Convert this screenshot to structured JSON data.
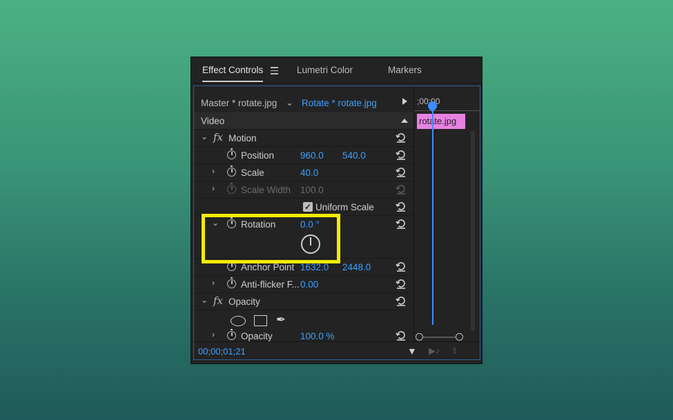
{
  "tabs": [
    {
      "label": "Effect Controls",
      "active": true
    },
    {
      "label": "Lumetri Color",
      "active": false
    },
    {
      "label": "Markers",
      "active": false
    }
  ],
  "clip_selector": {
    "master": "Master * rotate.jpg",
    "current": "Rotate * rotate.jpg"
  },
  "timeline": {
    "time": ";00:00",
    "clip_label": "rotate.jpg"
  },
  "section_video": "Video",
  "motion": {
    "title": "Motion",
    "position": {
      "label": "Position",
      "x": "960.0",
      "y": "540.0"
    },
    "scale": {
      "label": "Scale",
      "value": "40.0"
    },
    "scale_width": {
      "label": "Scale Width",
      "value": "100.0"
    },
    "uniform_scale": {
      "label": "Uniform Scale",
      "checked": true
    },
    "rotation": {
      "label": "Rotation",
      "value": "0.0 °"
    },
    "anchor_point": {
      "label": "Anchor Point",
      "x": "1632.0",
      "y": "2448.0"
    },
    "anti_flicker": {
      "label": "Anti-flicker F...",
      "value": "0.00"
    }
  },
  "opacity": {
    "title": "Opacity",
    "opacity_row": {
      "label": "Opacity",
      "value": "100.0 %"
    }
  },
  "footer": {
    "timecode": "00;00;01;21"
  },
  "colors": {
    "accent": "#3da0ff",
    "highlight": "#f4ec00",
    "clip": "#e782e2"
  }
}
